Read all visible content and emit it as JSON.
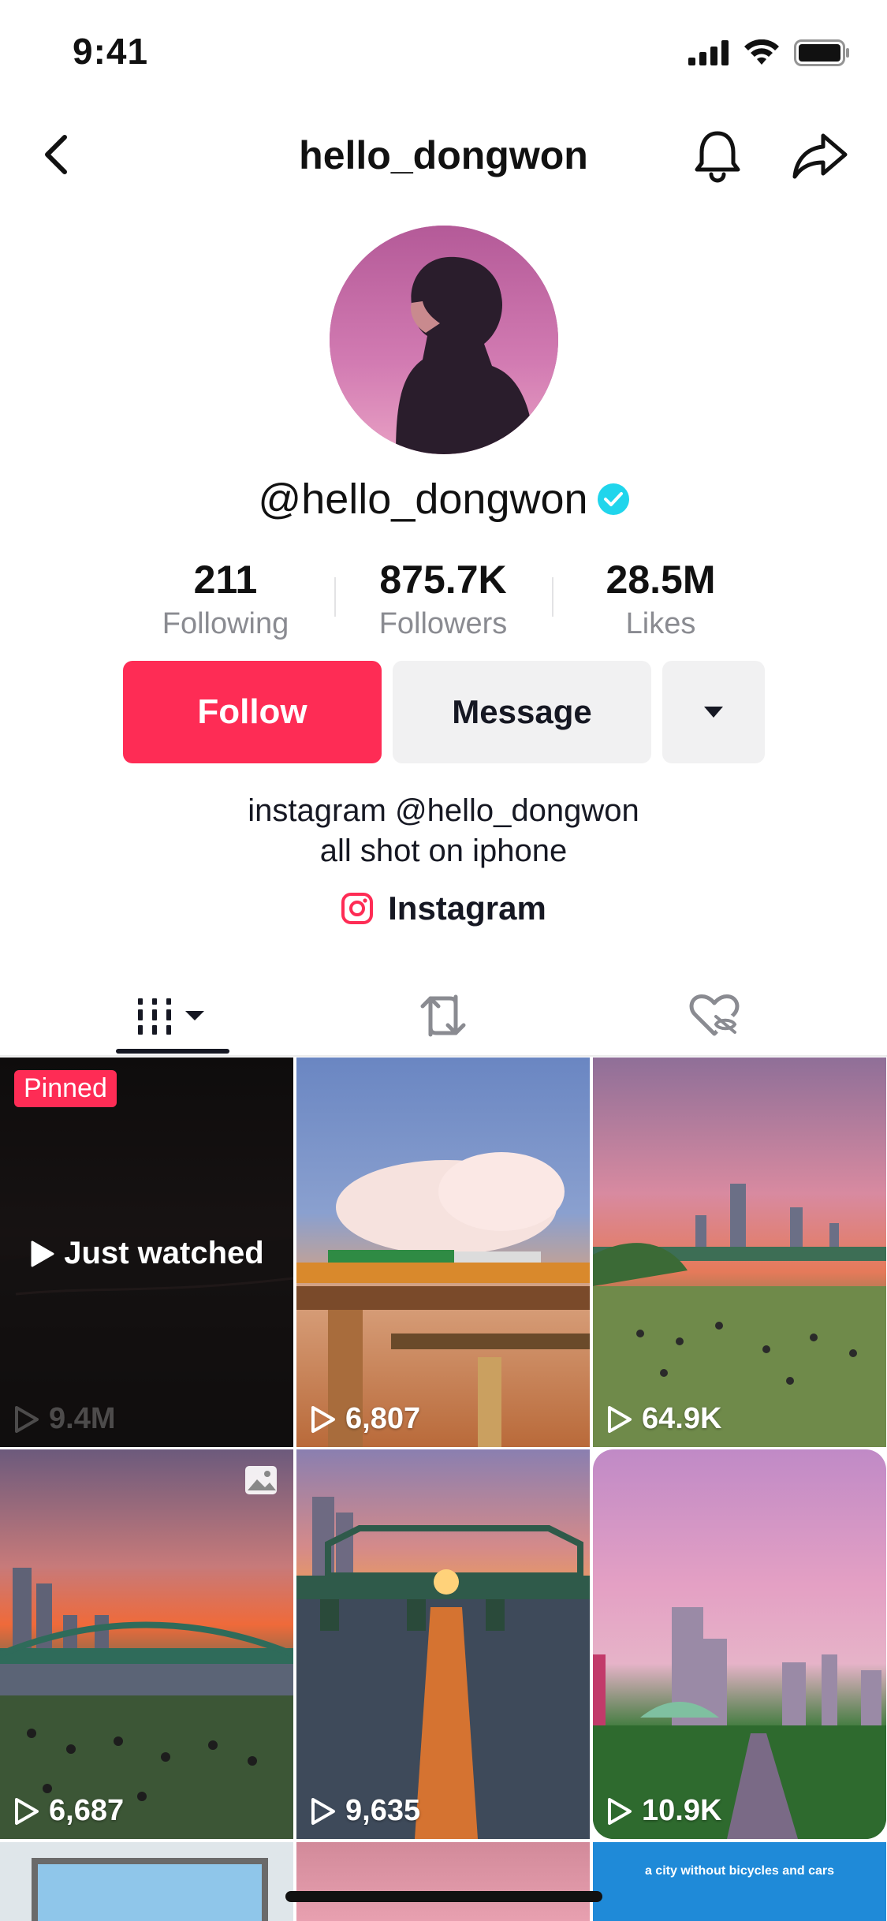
{
  "status_bar": {
    "time": "9:41"
  },
  "header": {
    "title": "hello_dongwon"
  },
  "profile": {
    "handle": "@hello_dongwon",
    "verified": true,
    "stats": [
      {
        "value": "211",
        "label": "Following"
      },
      {
        "value": "875.7K",
        "label": "Followers"
      },
      {
        "value": "28.5M",
        "label": "Likes"
      }
    ],
    "bio_lines": [
      "instagram @hello_dongwon",
      "all shot on iphone"
    ],
    "link_label": "Instagram"
  },
  "actions": {
    "follow_label": "Follow",
    "message_label": "Message"
  },
  "tabs": [
    {
      "icon": "videos-grid-icon",
      "selected": true
    },
    {
      "icon": "repost-icon",
      "selected": false
    },
    {
      "icon": "liked-hidden-icon",
      "selected": false
    }
  ],
  "colors": {
    "accent": "#fe2c55",
    "verified": "#20d5ec",
    "secondary_text": "#8a8b91"
  },
  "videos": [
    {
      "views": "9.4M",
      "pinned_label": "Pinned",
      "overlay_label": "Just watched"
    },
    {
      "views": "6,807"
    },
    {
      "views": "64.9K"
    },
    {
      "views": "6,687",
      "is_photo": true
    },
    {
      "views": "9,635"
    },
    {
      "views": "10.9K"
    }
  ],
  "partial_tiles": [
    {
      "caption": "a city without bicycles and cars"
    }
  ]
}
